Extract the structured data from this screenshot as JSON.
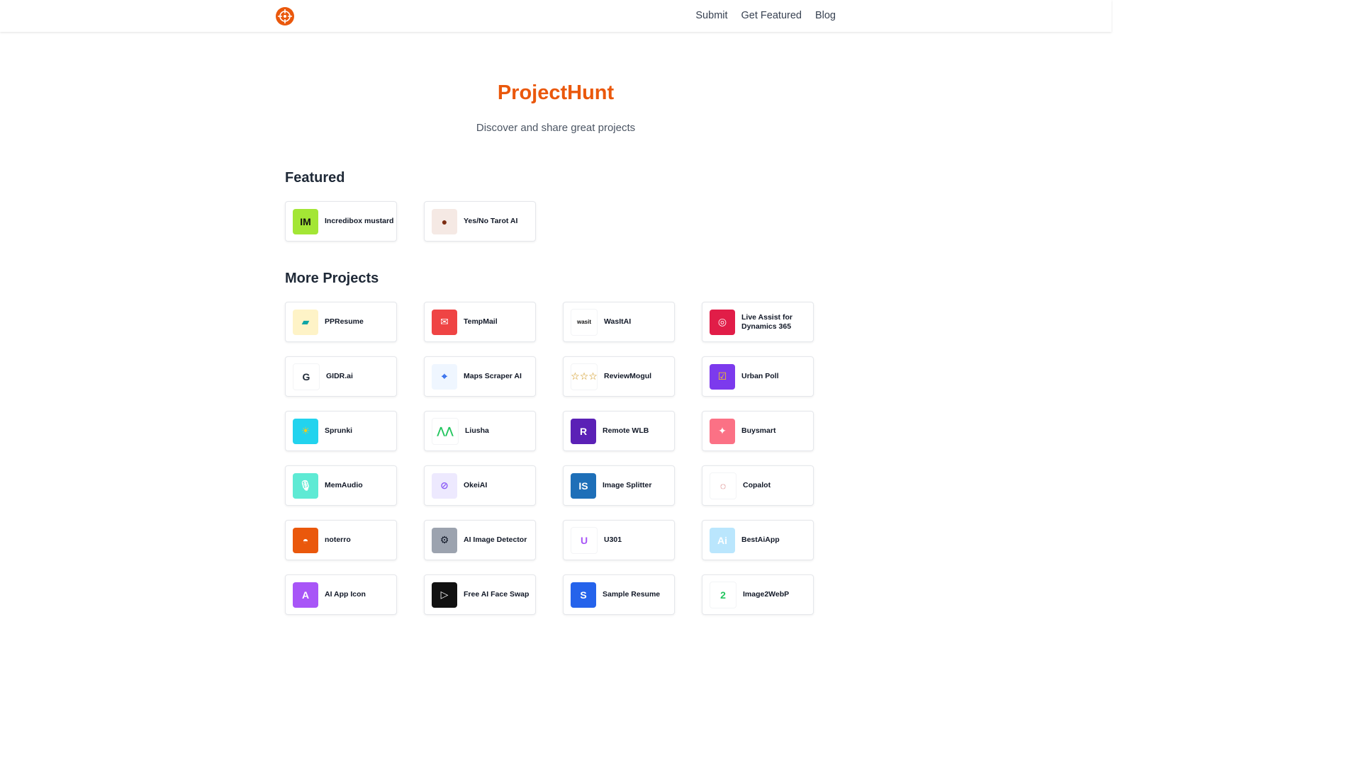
{
  "nav": {
    "links": [
      "Submit",
      "Get Featured",
      "Blog"
    ]
  },
  "hero": {
    "title": "ProjectHunt",
    "subtitle": "Discover and share great projects"
  },
  "featured": {
    "title": "Featured",
    "items": [
      {
        "name": "Incredibox mustard",
        "icon": "im-logo-icon",
        "color": "#a3e635",
        "fg": "#111111",
        "glyph": "IM"
      },
      {
        "name": "Yes/No Tarot AI",
        "icon": "tarot-portrait-icon",
        "color": "#f5e9e4",
        "fg": "#7c2d12",
        "glyph": "●"
      }
    ]
  },
  "more": {
    "title": "More Projects",
    "items": [
      {
        "name": "PPResume",
        "icon": "cards-stack-icon",
        "color": "#fef3c7",
        "fg": "#0ea5a5",
        "glyph": "▰"
      },
      {
        "name": "TempMail",
        "icon": "mail-icon",
        "color": "#ef4444",
        "fg": "#ffffff",
        "glyph": "✉"
      },
      {
        "name": "WasItAI",
        "icon": "wasitai-wordmark-icon",
        "color": "#ffffff",
        "fg": "#111111",
        "glyph": "wasit"
      },
      {
        "name": "Live Assist for Dynamics 365",
        "icon": "lifebuoy-icon",
        "color": "#e11d48",
        "fg": "#ffffff",
        "glyph": "◎"
      },
      {
        "name": "GIDR.ai",
        "icon": "g-letter-icon",
        "color": "#ffffff",
        "fg": "#1f2937",
        "glyph": "G"
      },
      {
        "name": "Maps Scraper AI",
        "icon": "map-pin-robot-icon",
        "color": "#eff6ff",
        "fg": "#2563eb",
        "glyph": "⌖"
      },
      {
        "name": "ReviewMogul",
        "icon": "stars-icon",
        "color": "#ffffff",
        "fg": "#ca8a04",
        "glyph": "☆☆☆"
      },
      {
        "name": "Urban Poll",
        "icon": "check-box-icon",
        "color": "#7c3aed",
        "fg": "#facc15",
        "glyph": "☑"
      },
      {
        "name": "Sprunki",
        "icon": "sun-character-icon",
        "color": "#22d3ee",
        "fg": "#facc15",
        "glyph": "☀"
      },
      {
        "name": "Liusha",
        "icon": "mountain-logo-icon",
        "color": "#ffffff",
        "fg": "#22c55e",
        "glyph": "⋀⋀"
      },
      {
        "name": "Remote WLB",
        "icon": "r-letter-icon",
        "color": "#5b21b6",
        "fg": "#ffffff",
        "glyph": "R"
      },
      {
        "name": "Buysmart",
        "icon": "sparkle-icon",
        "color": "#fb7185",
        "fg": "#ffffff",
        "glyph": "✦"
      },
      {
        "name": "MemAudio",
        "icon": "microphone-icon",
        "color": "#5eead4",
        "fg": "#ffffff",
        "glyph": "🎙"
      },
      {
        "name": "OkeiAI",
        "icon": "circle-lines-icon",
        "color": "#ede9fe",
        "fg": "#8b5cf6",
        "glyph": "⊘"
      },
      {
        "name": "Image Splitter",
        "icon": "is-letters-icon",
        "color": "#1e6fb8",
        "fg": "#ffffff",
        "glyph": "IS"
      },
      {
        "name": "Copalot",
        "icon": "dotted-ring-icon",
        "color": "#ffffff",
        "fg": "#b91c1c",
        "glyph": "◌"
      },
      {
        "name": "noterro",
        "icon": "bowl-logo-icon",
        "color": "#ea580c",
        "fg": "#ffffff",
        "glyph": "◓"
      },
      {
        "name": "AI Image Detector",
        "icon": "robot-face-icon",
        "color": "#9ca3af",
        "fg": "#111827",
        "glyph": "⚙"
      },
      {
        "name": "U301",
        "icon": "u-letter-icon",
        "color": "#ffffff",
        "fg": "#a855f7",
        "glyph": "U"
      },
      {
        "name": "BestAiApp",
        "icon": "ai-badge-icon",
        "color": "#bae6fd",
        "fg": "#ffffff",
        "glyph": "Ai"
      },
      {
        "name": "AI App Icon",
        "icon": "a-letter-icon",
        "color": "#a855f7",
        "fg": "#ffffff",
        "glyph": "A"
      },
      {
        "name": "Free AI Face Swap",
        "icon": "play-triangle-icon",
        "color": "#111111",
        "fg": "#ffffff",
        "glyph": "▷"
      },
      {
        "name": "Sample Resume",
        "icon": "s-letter-icon",
        "color": "#2563eb",
        "fg": "#ffffff",
        "glyph": "S"
      },
      {
        "name": "Image2WebP",
        "icon": "number-two-icon",
        "color": "#ffffff",
        "fg": "#22c55e",
        "glyph": "2"
      }
    ]
  }
}
